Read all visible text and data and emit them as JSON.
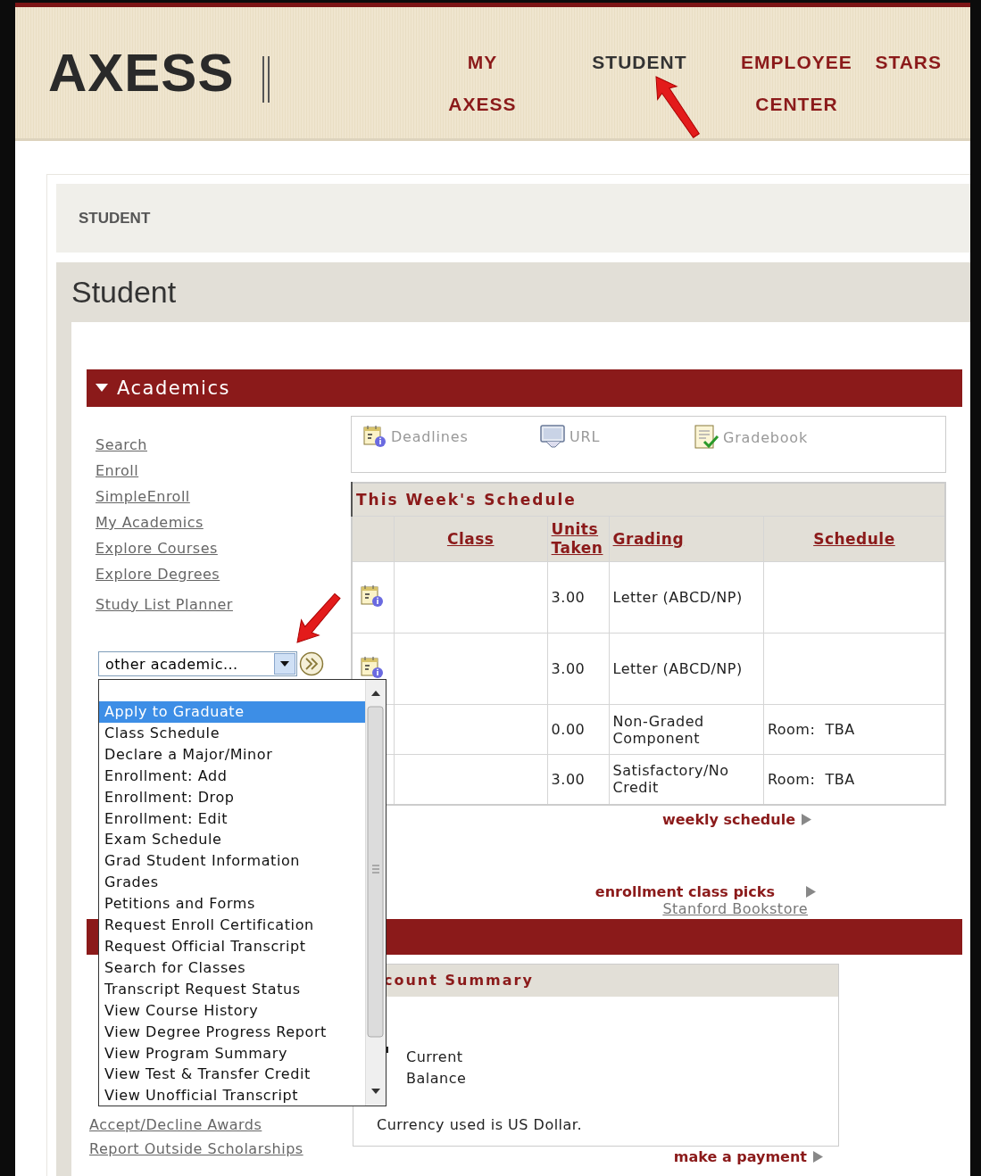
{
  "header": {
    "logo": "AXESS",
    "nav": [
      {
        "label": "MY AXESS",
        "selected": false
      },
      {
        "label": "STUDENT",
        "selected": true
      },
      {
        "label": "EMPLOYEE CENTER",
        "selected": false
      },
      {
        "label": "STARS",
        "selected": false
      }
    ]
  },
  "breadcrumb": "STUDENT",
  "page_title": "Student",
  "academics": {
    "title": "Academics",
    "expanded": true,
    "links": [
      "Search",
      "Enroll",
      "SimpleEnroll",
      "My Academics",
      "Explore Courses",
      "Explore Degrees",
      "Study List Planner"
    ],
    "select": {
      "value": "other academic...",
      "expanded": true,
      "options": [
        {
          "label": "Apply to Graduate",
          "selected": true
        },
        {
          "label": "Class Schedule",
          "selected": false
        },
        {
          "label": "Declare a Major/Minor",
          "selected": false
        },
        {
          "label": "Enrollment: Add",
          "selected": false
        },
        {
          "label": "Enrollment: Drop",
          "selected": false
        },
        {
          "label": "Enrollment: Edit",
          "selected": false
        },
        {
          "label": "Exam Schedule",
          "selected": false
        },
        {
          "label": "Grad Student Information",
          "selected": false
        },
        {
          "label": "Grades",
          "selected": false
        },
        {
          "label": "Petitions and Forms",
          "selected": false
        },
        {
          "label": "Request Enroll Certification",
          "selected": false
        },
        {
          "label": "Request Official Transcript",
          "selected": false
        },
        {
          "label": "Search for Classes",
          "selected": false
        },
        {
          "label": "Transcript Request Status",
          "selected": false
        },
        {
          "label": "View Course History",
          "selected": false
        },
        {
          "label": "View Degree Progress Report",
          "selected": false
        },
        {
          "label": "View Program Summary",
          "selected": false
        },
        {
          "label": "View Test & Transfer Credit",
          "selected": false
        },
        {
          "label": "View Unofficial Transcript",
          "selected": false
        }
      ]
    },
    "toolbar": [
      {
        "kind": "deadlines",
        "label": "Deadlines"
      },
      {
        "kind": "url",
        "label": "URL"
      },
      {
        "kind": "gradebook",
        "label": "Gradebook"
      }
    ],
    "schedule": {
      "title": "This Week's Schedule",
      "columns": [
        "Class",
        "Units Taken",
        "Grading",
        "Schedule"
      ],
      "rows": [
        {
          "icon": true,
          "units": "3.00",
          "grading": "Letter (ABCD/NP)"
        },
        {
          "icon": true,
          "units": "3.00",
          "grading": "Letter (ABCD/NP)"
        },
        {
          "icon": false,
          "units": "0.00",
          "grading": "Non-Graded Component",
          "schedule": "Room:  TBA"
        },
        {
          "icon": false,
          "units": "3.00",
          "grading": "Satisfactory/No Credit",
          "schedule": "Room:  TBA"
        }
      ]
    },
    "weekly_link": "weekly schedule",
    "picks_link": "enrollment class picks",
    "bookstore_link": "Stanford Bookstore"
  },
  "finance": {
    "links": [
      "Accept/Decline Awards",
      "Report Outside Scholarships"
    ],
    "account": {
      "title": "count Summary",
      "balance_label": "Current Balance",
      "currency_note": "Currency used is US Dollar.",
      "payment_link": "make a payment"
    }
  }
}
